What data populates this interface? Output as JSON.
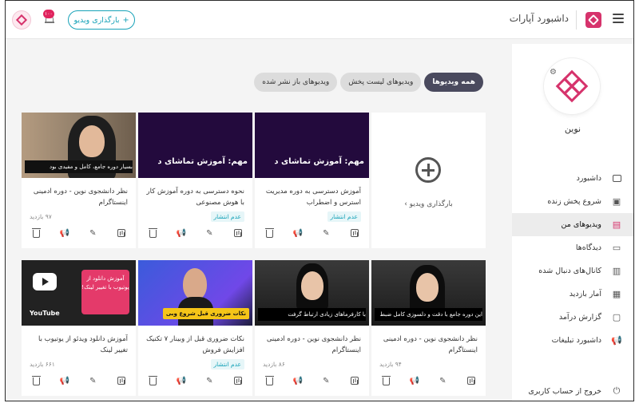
{
  "header": {
    "title": "داشبورد آپارات",
    "upload_button": "بارگذاری ویدیو",
    "notifications_badge": "۱۰۰"
  },
  "sidebar": {
    "profile_name": "نوین",
    "items": [
      {
        "label": "داشبورد",
        "icon": "dashboard-icon"
      },
      {
        "label": "شروع پخش زنده",
        "icon": "live-icon"
      },
      {
        "label": "ویدیوهای من",
        "icon": "videos-icon",
        "active": true
      },
      {
        "label": "دیدگاه‌ها",
        "icon": "comments-icon"
      },
      {
        "label": "کانال‌های دنبال شده",
        "icon": "channels-icon"
      },
      {
        "label": "آمار بازدید",
        "icon": "stats-icon"
      },
      {
        "label": "گزارش درآمد",
        "icon": "income-icon"
      },
      {
        "label": "داشبورد تبلیغات",
        "icon": "ads-icon"
      }
    ],
    "logout": "خروج از حساب کاربری"
  },
  "tabs": [
    {
      "label": "همه ویدیوها",
      "active": true
    },
    {
      "label": "ویدیوهای لیست پخش",
      "active": false
    },
    {
      "label": "ویدیوهای باز نشر شده",
      "active": false
    }
  ],
  "upload_card": {
    "label": "بارگذاری ویدیو ›"
  },
  "videos": [
    {
      "title": "آموزش دسترسی به دوره مدیریت استرس و اضطراب",
      "status": "عدم انتشار",
      "views": "",
      "thumb_caption": "مهم: آموزش تماشای د"
    },
    {
      "title": "نحوه دسترسی به دوره آموزش کار با هوش مصنوعی",
      "status": "عدم انتشار",
      "views": "",
      "thumb_caption": "مهم: آموزش تماشای د"
    },
    {
      "title": "نظر دانشجوی نوین - دوره ادمینی اینستاگرام",
      "status": "",
      "views": "۹۷ بازدید",
      "thumb_caption": "بسیار دوره جامع، کامل و مفیدی بود"
    },
    {
      "title": "نظر دانشجوی نوین - دوره ادمینی اینستاگرام",
      "status": "",
      "views": "۹۴ بازدید",
      "thumb_caption": "این دوره جامع با دقت و دلسوزی کامل ضبط"
    },
    {
      "title": "نظر دانشجوی نوین - دوره ادمینی اینستاگرام",
      "status": "",
      "views": "۸۶ بازدید",
      "thumb_caption": "با کارفرماهای زیادی ارتباط گرفت"
    },
    {
      "title": "نکات ضروری قبل از وبینار ۷ تکنیک افزایش فروش",
      "status": "عدم انتشار",
      "views": "",
      "thumb_caption": "نکات ضروری قبل شروع وبی"
    },
    {
      "title": "آموزش دانلود ویدئو از یوتیوب با تغییر لینک",
      "status": "",
      "views": "۶۶۱ بازدید",
      "thumb_caption": "آموزش دانلود از یوتیوب با تغییر لینک!"
    }
  ],
  "yt_label": "YouTube"
}
